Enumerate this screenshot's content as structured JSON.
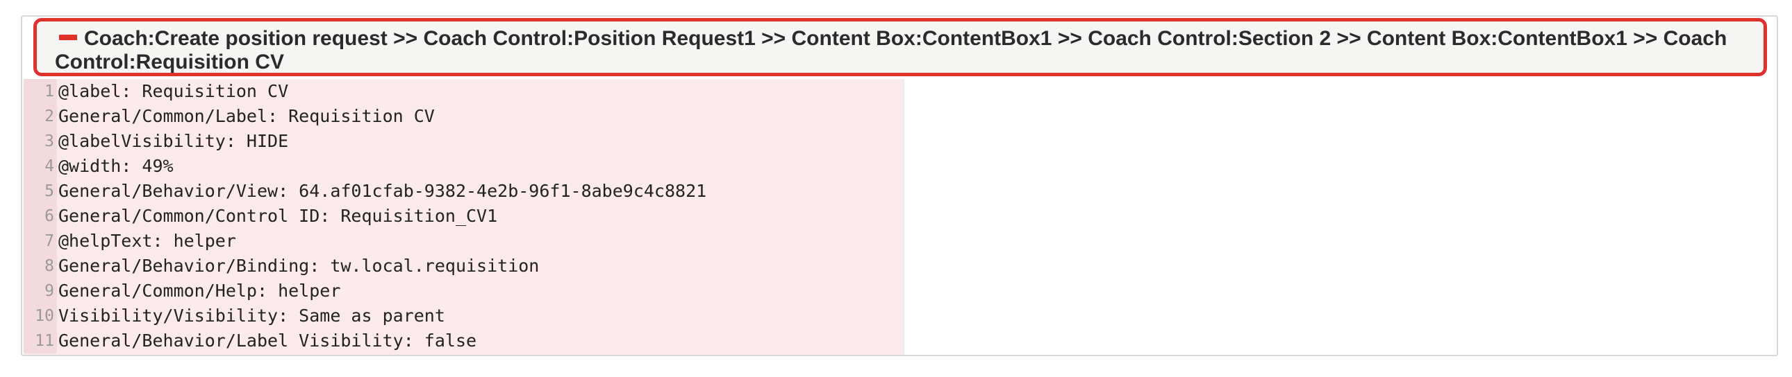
{
  "header": {
    "text": "Coach:Create position request >> Coach Control:Position Request1 >> Content Box:ContentBox1 >> Coach Control:Section 2 >> Content Box:ContentBox1 >> Coach Control:Requisition CV"
  },
  "lines": [
    {
      "num": "1",
      "text": "@label: Requisition CV"
    },
    {
      "num": "2",
      "text": "General/Common/Label: Requisition CV"
    },
    {
      "num": "3",
      "text": "@labelVisibility: HIDE"
    },
    {
      "num": "4",
      "text": "@width: 49%"
    },
    {
      "num": "5",
      "text": "General/Behavior/View: 64.af01cfab-9382-4e2b-96f1-8abe9c4c8821"
    },
    {
      "num": "6",
      "text": "General/Common/Control ID: Requisition_CV1"
    },
    {
      "num": "7",
      "text": "@helpText: helper"
    },
    {
      "num": "8",
      "text": "General/Behavior/Binding: tw.local.requisition"
    },
    {
      "num": "9",
      "text": "General/Common/Help: helper"
    },
    {
      "num": "10",
      "text": "Visibility/Visibility: Same as parent"
    },
    {
      "num": "11",
      "text": "General/Behavior/Label Visibility: false"
    }
  ],
  "colors": {
    "highlight_border": "#e0312b",
    "removed_background": "#fbeaec"
  }
}
